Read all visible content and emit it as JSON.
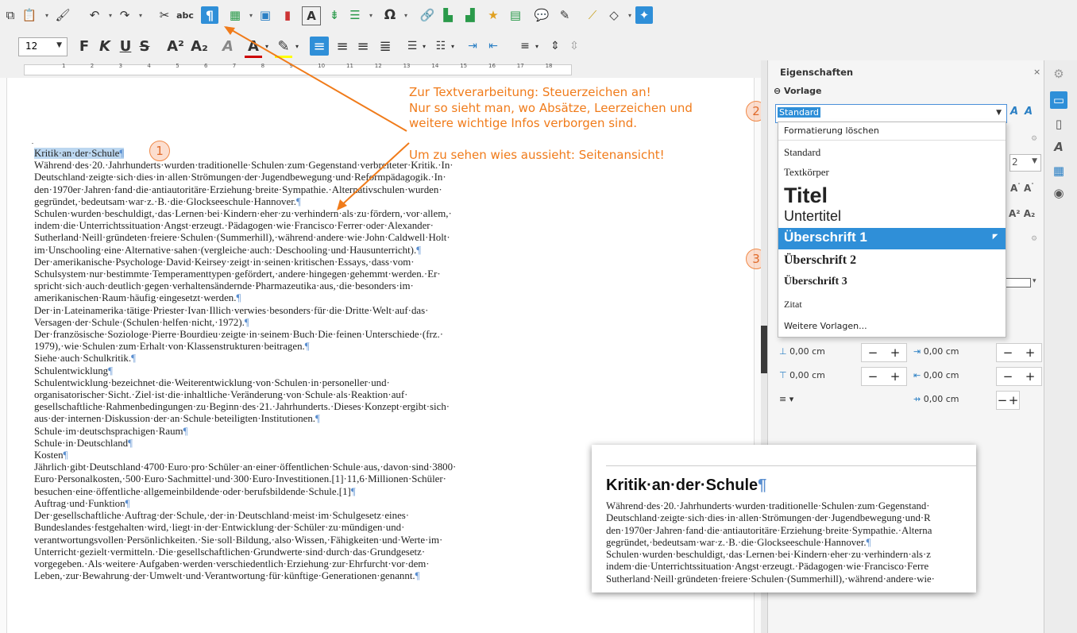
{
  "toolbar": {
    "font_size": "12",
    "bold_label": "F",
    "italic_label": "K",
    "underline_label": "U",
    "strike_label": "S",
    "super_label": "A²",
    "sub_label": "A₂",
    "omega_label": "Ω",
    "spell_label": "abc",
    "pilcrow": "¶",
    "A_label": "A"
  },
  "ruler": {
    "ticks": [
      "1",
      "2",
      "3",
      "4",
      "5",
      "6",
      "7",
      "8",
      "9",
      "10",
      "11",
      "12",
      "13",
      "14",
      "15",
      "16",
      "17",
      "18"
    ]
  },
  "annotation": {
    "line1": "Zur Textverarbeitung: Steuerzeichen an!",
    "line2": "Nur so sieht man, wo Absätze, Leerzeichen und",
    "line3": "weitere wichtige Infos verborgen sind.",
    "line4": "Um zu sehen wies aussieht: Seitenansicht!",
    "badge1": "1",
    "badge2": "2",
    "badge3": "3"
  },
  "document": {
    "lines": [
      "Kritik·an·der·Schule¶",
      "Während·des·20.·Jahrhunderts·wurden·traditionelle·Schulen·zum·Gegenstand·verbreiteter·Kritik.·In·",
      "Deutschland·zeigte·sich·dies·in·allen·Strömungen·der·Jugendbewegung·und·Reformpädagogik.·In·",
      "den·1970er·Jahren·fand·die·antiautoritäre·Erziehung·breite·Sympathie.·Alternativschulen·wurden·",
      "gegründet,·bedeutsam·war·z.·B.·die·Glockseeschule·Hannover.¶",
      "Schulen·wurden·beschuldigt,·das·Lernen·bei·Kindern·eher·zu·verhindern·als·zu·fördern,·vor·allem,·",
      "indem·die·Unterrichtssituation·Angst·erzeugt.·Pädagogen·wie·Francisco·Ferrer·oder·Alexander·",
      "Sutherland·Neill·gründeten·freiere·Schulen·(Summerhill),·während·andere·wie·John·Caldwell·Holt·",
      "im·Unschooling·eine·Alternative·sahen·(vergleiche·auch:·Deschooling·und·Hausunterricht).¶",
      "Der·amerikanische·Psychologe·David·Keirsey·zeigt·in·seinen·kritischen·Essays,·dass·vom·",
      "Schulsystem·nur·bestimmte·Temperamenttypen·gefördert,·andere·hingegen·gehemmt·werden.·Er·",
      "spricht·sich·auch·deutlich·gegen·verhaltensändernde·Pharmazeutika·aus,·die·besonders·im·",
      "amerikanischen·Raum·häufig·eingesetzt·werden.¶",
      "Der·in·Lateinamerika·tätige·Priester·Ivan·Illich·verwies·besonders·für·die·Dritte·Welt·auf·das·",
      "Versagen·der·Schule·(Schulen·helfen·nicht,·1972).¶",
      "Der·französische·Soziologe·Pierre·Bourdieu·zeigte·in·seinem·Buch·Die·feinen·Unterschiede·(frz.·",
      "1979),·wie·Schulen·zum·Erhalt·von·Klassenstrukturen·beitragen.¶",
      "Siehe·auch·Schulkritik.¶",
      "Schulentwicklung¶",
      "Schulentwicklung·bezeichnet·die·Weiterentwicklung·von·Schulen·in·personeller·und·",
      "organisatorischer·Sicht.·Ziel·ist·die·inhaltliche·Veränderung·von·Schule·als·Reaktion·auf·",
      "gesellschaftliche·Rahmenbedingungen·zu·Beginn·des·21.·Jahrhunderts.·Dieses·Konzept·ergibt·sich·",
      "aus·der·internen·Diskussion·der·an·Schule·beteiligten·Institutionen.¶",
      "Schule·im·deutschsprachigen·Raum¶",
      "Schule·in·Deutschland¶",
      "Kosten¶",
      "Jährlich·gibt·Deutschland·4700·Euro·pro·Schüler·an·einer·öffentlichen·Schule·aus,·davon·sind·3800·",
      "Euro·Personalkosten,·500·Euro·Sachmittel·und·300·Euro·Investitionen.[1]·11,6·Millionen·Schüler·",
      "besuchen·eine·öffentliche·allgemeinbildende·oder·berufsbildende·Schule.[1]¶",
      "Auftrag·und·Funktion¶",
      "Der·gesellschaftliche·Auftrag·der·Schule,·der·in·Deutschland·meist·im·Schulgesetz·eines·",
      "Bundeslandes·festgehalten·wird,·liegt·in·der·Entwicklung·der·Schüler·zu·mündigen·und·",
      "verantwortungsvollen·Persönlichkeiten.·Sie·soll·Bildung,·also·Wissen,·Fähigkeiten·und·Werte·im·",
      "Unterricht·gezielt·vermitteln.·Die·gesellschaftlichen·Grundwerte·sind·durch·das·Grundgesetz·",
      "vorgegeben.·Als·weitere·Aufgaben·werden·verschiedentlich·Erziehung·zur·Ehrfurcht·vor·dem·",
      "Leben,·zur·Bewahrung·der·Umwelt·und·Verantwortung·für·künftige·Generationen·genannt.¶"
    ]
  },
  "sidebar": {
    "title": "Eigenschaften",
    "close": "×",
    "section_vorlage": "Vorlage",
    "style_value": "Standard",
    "spin_value": "2",
    "dropdown_items": [
      "Formatierung löschen",
      "Standard",
      "Textkörper",
      "Titel",
      "Untertitel",
      "Überschrift 1",
      "Überschrift 2",
      "Überschrift 3",
      "Zitat",
      "Weitere Vorlagen..."
    ],
    "spacing": [
      "0,00 cm",
      "0,00 cm",
      "0,00 cm",
      "0,00 cm",
      "0,00 cm"
    ],
    "minus": "−",
    "plus": "+"
  },
  "preview": {
    "title": "Kritik·an·der·Schule¶",
    "lines": [
      "Während·des·20.·Jahrhunderts·wurden·traditionelle·Schulen·zum·Gegenstand·",
      "Deutschland·zeigte·sich·dies·in·allen·Strömungen·der·Jugendbewegung·und·R",
      "den·1970er·Jahren·fand·die·antiautoritäre·Erziehung·breite·Sympathie.·Alterna",
      "gegründet,·bedeutsam·war·z.·B.·die·Glockseeschule·Hannover.¶",
      "Schulen·wurden·beschuldigt,·das·Lernen·bei·Kindern·eher·zu·verhindern·als·z",
      "indem·die·Unterrichtssituation·Angst·erzeugt.·Pädagogen·wie·Francisco·Ferre",
      "Sutherland·Neill·gründeten·freiere·Schulen·(Summerhill),·während·andere·wie·"
    ]
  },
  "colors": {
    "accent": "#2f8fd8",
    "annotation": "#f07b1a"
  }
}
